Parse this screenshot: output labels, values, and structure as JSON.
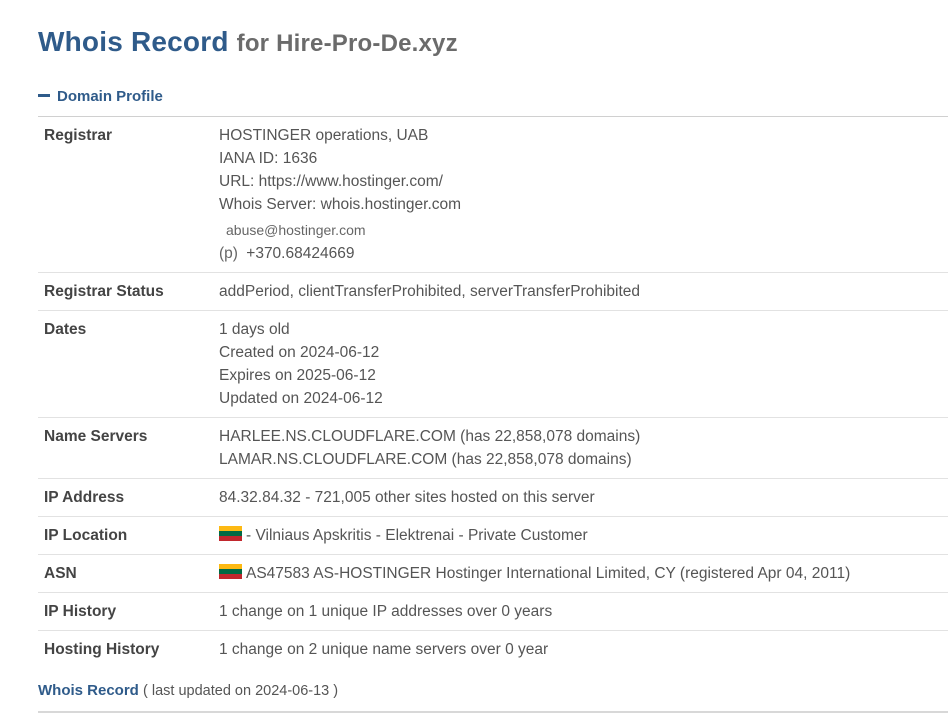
{
  "header": {
    "title": "Whois Record",
    "subtitle": "for Hire-Pro-De.xyz"
  },
  "section": {
    "label": "Domain Profile",
    "icon": "minus-icon"
  },
  "registrar": {
    "label": "Registrar",
    "name": "HOSTINGER operations, UAB",
    "iana": "IANA ID: 1636",
    "url": "URL: https://www.hostinger.com/",
    "whois_server": "Whois Server: whois.hostinger.com",
    "email": "abuse@hostinger.com",
    "phone_prefix": "(p)",
    "phone": "+370.68424669"
  },
  "registrar_status": {
    "label": "Registrar Status",
    "value": "addPeriod, clientTransferProhibited, serverTransferProhibited"
  },
  "dates": {
    "label": "Dates",
    "age": "1 days old",
    "created": "Created on 2024-06-12",
    "expires": "Expires on 2025-06-12",
    "updated": "Updated on 2024-06-12"
  },
  "name_servers": {
    "label": "Name Servers",
    "ns1": "HARLEE.NS.CLOUDFLARE.COM (has 22,858,078 domains)",
    "ns2": "LAMAR.NS.CLOUDFLARE.COM (has 22,858,078 domains)"
  },
  "ip_address": {
    "label": "IP Address",
    "value": "84.32.84.32 - 721,005 other sites hosted on this server"
  },
  "ip_location": {
    "label": "IP Location",
    "value": "- Vilniaus Apskritis - Elektrenai - Private Customer",
    "flag": "lithuania-flag"
  },
  "asn": {
    "label": "ASN",
    "value": "AS47583 AS-HOSTINGER Hostinger International Limited, CY (registered Apr 04, 2011)",
    "flag": "lithuania-flag"
  },
  "ip_history": {
    "label": "IP History",
    "value": "1 change on 1 unique IP addresses over 0 years"
  },
  "hosting_history": {
    "label": "Hosting History",
    "value": "1 change on 2 unique name servers over 0 year"
  },
  "footer": {
    "title": "Whois Record",
    "updated": "( last updated on 2024-06-13 )"
  },
  "colors": {
    "accent": "#2f5b8a",
    "text": "#555555",
    "rule": "#e2e2e2"
  }
}
